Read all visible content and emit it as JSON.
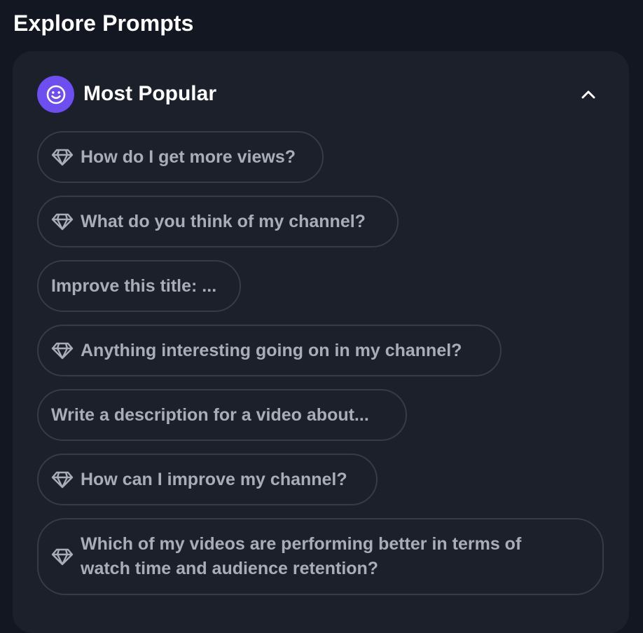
{
  "header": {
    "title": "Explore Prompts"
  },
  "section": {
    "title": "Most Popular",
    "icon": "smiley-icon",
    "collapse_icon": "chevron-up-icon",
    "accent_color": "#6d4ef0"
  },
  "prompts": [
    {
      "label": "How do I get more views?",
      "icon": "gem-icon"
    },
    {
      "label": "What do you think of my channel?",
      "icon": "gem-icon"
    },
    {
      "label": "Improve this title: ...",
      "icon": ""
    },
    {
      "label": "Anything interesting going on in my channel?",
      "icon": "gem-icon"
    },
    {
      "label": "Write a description for a video about...",
      "icon": ""
    },
    {
      "label": "How can I improve my channel?",
      "icon": "gem-icon"
    },
    {
      "label": "Which of my videos are performing better in terms of watch time and audience retention?",
      "icon": "gem-icon"
    }
  ]
}
